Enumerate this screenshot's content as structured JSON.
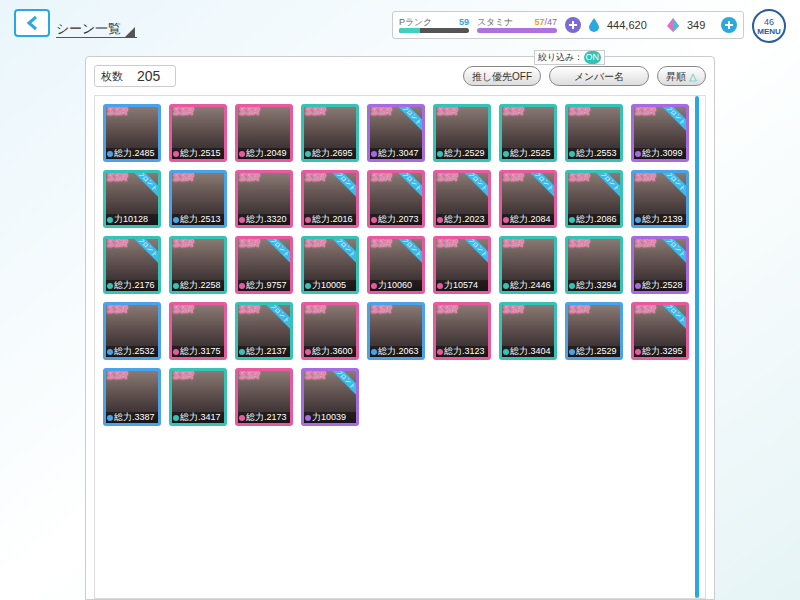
{
  "header": {
    "title": "シーン一覧"
  },
  "status": {
    "rank_label": "Pランク",
    "rank": "59",
    "rank_level": 0.3,
    "stamina_label": "スタミナ",
    "stamina": "57",
    "stamina_max": "/47",
    "stamina_level": 1.0,
    "coins": "444,620",
    "gems": "349"
  },
  "menu": {
    "label": "MENU",
    "badge": "46"
  },
  "toolbar": {
    "count_label": "枚数",
    "count": "205",
    "oshi_button": "推し優先OFF",
    "filter_label": "絞り込み：",
    "filter_value": "ON",
    "sort_key_button": "メンバー名",
    "order_button": "昇順",
    "order_icon": "△"
  },
  "ribbon_label": "フロント",
  "cards": [
    {
      "rarity": "SSR",
      "front": false,
      "power": "総力.2485",
      "color": "#4aa3e8"
    },
    {
      "rarity": "SSR",
      "front": false,
      "power": "総力.2515",
      "color": "#e85aa0"
    },
    {
      "rarity": "SSR",
      "front": false,
      "power": "総力.2049",
      "color": "#e85aa0"
    },
    {
      "rarity": "SSR",
      "front": false,
      "power": "総力.2695",
      "color": "#36c2b4"
    },
    {
      "rarity": "SSR",
      "front": true,
      "power": "総力.3047",
      "color": "#a66be0"
    },
    {
      "rarity": "SSR",
      "front": false,
      "power": "総力.2529",
      "color": "#36c2b4"
    },
    {
      "rarity": "SSR",
      "front": false,
      "power": "総力.2525",
      "color": "#36c2b4"
    },
    {
      "rarity": "SSR",
      "front": false,
      "power": "総力.2553",
      "color": "#36c2b4"
    },
    {
      "rarity": "SSR",
      "front": true,
      "power": "総力.3099",
      "color": "#a66be0"
    },
    {
      "rarity": "SSR",
      "front": true,
      "power": "力10128",
      "color": "#36c2b4"
    },
    {
      "rarity": "SSR",
      "front": false,
      "power": "総力.2513",
      "color": "#4aa3e8"
    },
    {
      "rarity": "SSR",
      "front": false,
      "power": "総力.3320",
      "color": "#e85aa0"
    },
    {
      "rarity": "SSR",
      "front": true,
      "power": "総力.2016",
      "color": "#e85aa0"
    },
    {
      "rarity": "SSR",
      "front": true,
      "power": "総力.2073",
      "color": "#e85aa0"
    },
    {
      "rarity": "SSR",
      "front": true,
      "power": "総力.2023",
      "color": "#e85aa0"
    },
    {
      "rarity": "SSR",
      "front": true,
      "power": "総力.2084",
      "color": "#e85aa0"
    },
    {
      "rarity": "SSR",
      "front": true,
      "power": "総力.2086",
      "color": "#36c2b4"
    },
    {
      "rarity": "SSR",
      "front": true,
      "power": "総力.2139",
      "color": "#4aa3e8"
    },
    {
      "rarity": "SSR",
      "front": true,
      "power": "総力.2176",
      "color": "#36c2b4"
    },
    {
      "rarity": "SSR",
      "front": false,
      "power": "総力.2258",
      "color": "#36c2b4"
    },
    {
      "rarity": "SSR",
      "front": true,
      "power": "総力.9757",
      "color": "#e85aa0"
    },
    {
      "rarity": "SSR",
      "front": true,
      "power": "力10005",
      "color": "#36c2b4"
    },
    {
      "rarity": "SSR",
      "front": true,
      "power": "力10060",
      "color": "#e85aa0"
    },
    {
      "rarity": "SSR",
      "front": true,
      "power": "力10574",
      "color": "#e85aa0"
    },
    {
      "rarity": "SSR",
      "front": false,
      "power": "総力.2446",
      "color": "#36c2b4"
    },
    {
      "rarity": "SSR",
      "front": false,
      "power": "総力.3294",
      "color": "#36c2b4"
    },
    {
      "rarity": "SSR",
      "front": true,
      "power": "総力.2528",
      "color": "#a66be0"
    },
    {
      "rarity": "SSR",
      "front": false,
      "power": "総力.2532",
      "color": "#4aa3e8"
    },
    {
      "rarity": "SSR",
      "front": false,
      "power": "総力.3175",
      "color": "#e85aa0"
    },
    {
      "rarity": "SSR",
      "front": true,
      "power": "総力.2137",
      "color": "#36c2b4"
    },
    {
      "rarity": "SSR",
      "front": false,
      "power": "総力.3600",
      "color": "#e85aa0"
    },
    {
      "rarity": "SSR",
      "front": false,
      "power": "総力.2063",
      "color": "#4aa3e8"
    },
    {
      "rarity": "SSR",
      "front": false,
      "power": "総力.3123",
      "color": "#e85aa0"
    },
    {
      "rarity": "SSR",
      "front": false,
      "power": "総力.3404",
      "color": "#36c2b4"
    },
    {
      "rarity": "SSR",
      "front": false,
      "power": "総力.2529",
      "color": "#4aa3e8"
    },
    {
      "rarity": "SSR",
      "front": true,
      "power": "総力.3295",
      "color": "#e85aa0"
    },
    {
      "rarity": "SSR",
      "front": false,
      "power": "総力.3387",
      "color": "#4aa3e8"
    },
    {
      "rarity": "SSR",
      "front": false,
      "power": "総力.3417",
      "color": "#36c2b4"
    },
    {
      "rarity": "SSR",
      "front": false,
      "power": "総力.2173",
      "color": "#e85aa0"
    },
    {
      "rarity": "SSR",
      "front": true,
      "power": "力10039",
      "color": "#a66be0"
    }
  ]
}
